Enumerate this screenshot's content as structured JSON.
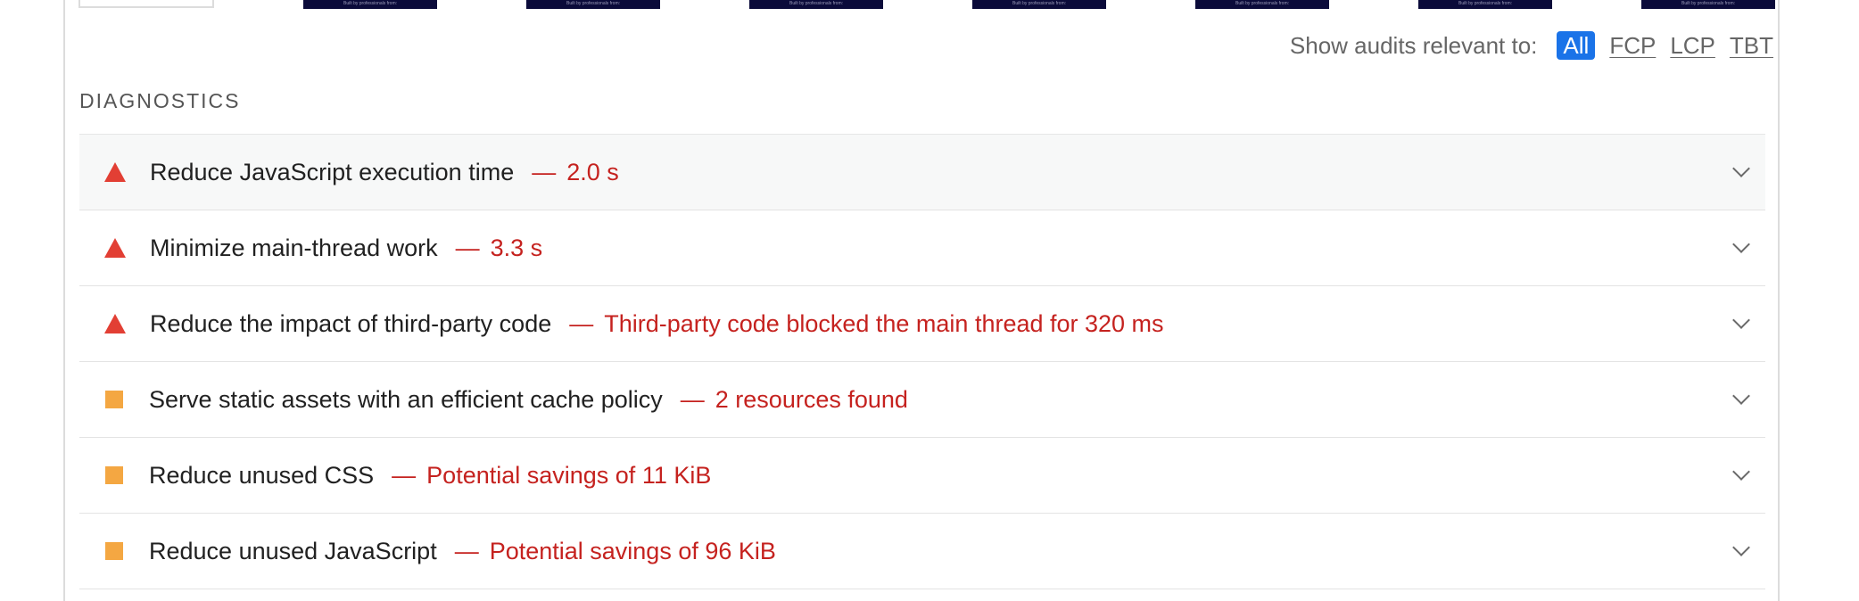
{
  "filmstrip": {
    "thumb_caption": "Built by professionals from:"
  },
  "filter": {
    "label": "Show audits relevant to:",
    "options": [
      "All",
      "FCP",
      "LCP",
      "TBT"
    ],
    "active": "All",
    "active_color": "#1a73e8"
  },
  "diagnostics": {
    "title": "DIAGNOSTICS",
    "audits": [
      {
        "icon": "fail-triangle-icon",
        "title": "Reduce JavaScript execution time",
        "value": "2.0 s"
      },
      {
        "icon": "fail-triangle-icon",
        "title": "Minimize main-thread work",
        "value": "3.3 s"
      },
      {
        "icon": "fail-triangle-icon",
        "title": "Reduce the impact of third-party code",
        "value": "Third-party code blocked the main thread for 320 ms"
      },
      {
        "icon": "average-square-icon",
        "title": "Serve static assets with an efficient cache policy",
        "value": "2 resources found"
      },
      {
        "icon": "average-square-icon",
        "title": "Reduce unused CSS",
        "value": "Potential savings of 11 KiB"
      },
      {
        "icon": "average-square-icon",
        "title": "Reduce unused JavaScript",
        "value": "Potential savings of 96 KiB"
      }
    ],
    "separator": "—",
    "colors": {
      "fail": "#e23f34",
      "average": "#f4a742",
      "value_text": "#c5221f"
    }
  }
}
